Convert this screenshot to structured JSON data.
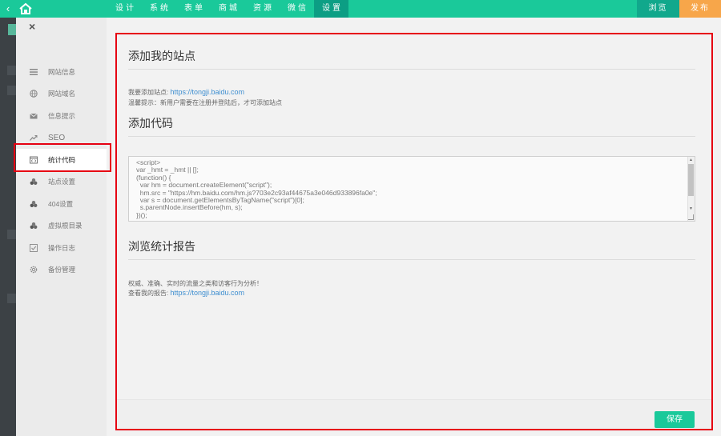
{
  "topbar": {
    "back_icon": "chevron-left-icon",
    "home_icon": "home-icon",
    "nav": [
      "设计",
      "系统",
      "表单",
      "商城",
      "资源",
      "微信",
      "设置"
    ],
    "active_nav": "设置",
    "browse_label": "浏览",
    "publish_label": "发布",
    "colors": {
      "bar": "#1ac99a",
      "active": "#0c9e84",
      "browse": "#11a88c",
      "publish": "#f7a64a"
    }
  },
  "sidebar": {
    "close_label": "×",
    "items": [
      {
        "label": "网站信息",
        "icon": "list-icon"
      },
      {
        "label": "网站域名",
        "icon": "globe-icon"
      },
      {
        "label": "信息提示",
        "icon": "mail-icon"
      },
      {
        "label": "SEO",
        "icon": "trend-icon"
      },
      {
        "label": "统计代码",
        "icon": "code-icon",
        "active": true
      },
      {
        "label": "站点设置",
        "icon": "cluster-icon"
      },
      {
        "label": "404设置",
        "icon": "cluster-icon"
      },
      {
        "label": "虚拟根目录",
        "icon": "cluster-icon"
      },
      {
        "label": "操作日志",
        "icon": "checklist-icon"
      },
      {
        "label": "备份管理",
        "icon": "gear-icon"
      }
    ]
  },
  "main": {
    "section1": {
      "title": "添加我的站点",
      "add_prefix": "我要添加站点:",
      "add_link": "https://tongji.baidu.com",
      "tip": "温馨提示：新用户需要在注册并登陆后，才可添加站点"
    },
    "section2": {
      "title": "添加代码",
      "code": "<script>\nvar _hmt = _hmt || [];\n(function() {\n  var hm = document.createElement(\"script\");\n  hm.src = \"https://hm.baidu.com/hm.js?703e2c93af44675a3e046d933896fa0e\";\n  var s = document.getElementsByTagName(\"script\")[0];\n  s.parentNode.insertBefore(hm, s);\n})();"
    },
    "section3": {
      "title": "浏览统计报告",
      "desc": "权威、准确、实时的流量之类和访客行为分析！",
      "report_prefix": "查看我的报告:",
      "report_link": "https://tongji.baidu.com"
    },
    "save_label": "保存"
  }
}
